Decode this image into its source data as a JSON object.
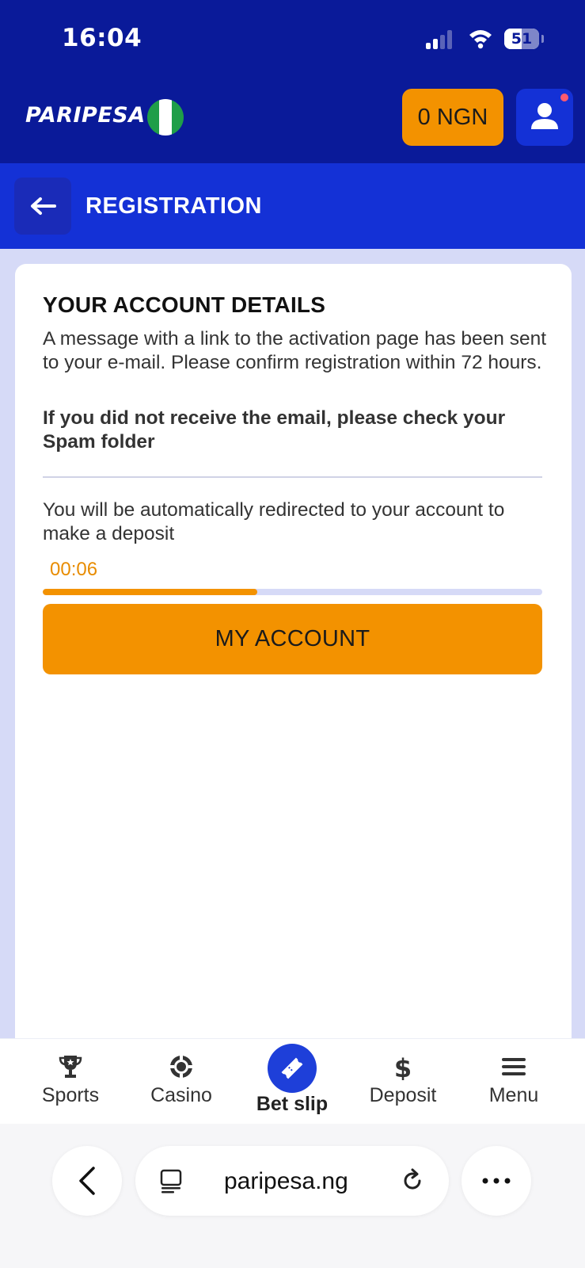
{
  "status_bar": {
    "time": "16:04",
    "battery_level": "51",
    "icons": [
      "cellular-signal-icon",
      "wifi-icon",
      "battery-icon"
    ]
  },
  "header": {
    "logo": "PARIPESA",
    "flag_icon": "nigeria-flag-icon",
    "balance": "0 NGN",
    "profile_icon": "user-icon",
    "colors": {
      "header_bg": "#0a1a99",
      "accent": "#f39200"
    }
  },
  "subheader": {
    "back_icon": "arrow-left-icon",
    "title": "REGISTRATION",
    "bg": "#1431d6"
  },
  "account": {
    "title": "YOUR ACCOUNT DETAILS",
    "message": "A message with a link to the activation page has been sent to your e-mail. Please confirm registration within 72 hours.",
    "warning": "If you did not receive the email, please check your Spam folder",
    "redirect_text": "You will be automatically redirected to your account to make a deposit",
    "timer": "00:06",
    "progress_fraction": 0.43,
    "button_label": "MY ACCOUNT"
  },
  "bottom_nav": {
    "items": [
      {
        "label": "Sports",
        "icon": "trophy-icon"
      },
      {
        "label": "Casino",
        "icon": "casino-chip-icon"
      },
      {
        "label": "Bet slip",
        "icon": "ticket-icon"
      },
      {
        "label": "Deposit",
        "icon": "dollar-icon"
      },
      {
        "label": "Menu",
        "icon": "hamburger-icon"
      }
    ]
  },
  "browser": {
    "url": "paripesa.ng",
    "icons": [
      "chevron-left-icon",
      "reader-icon",
      "reload-icon",
      "more-icon"
    ]
  }
}
